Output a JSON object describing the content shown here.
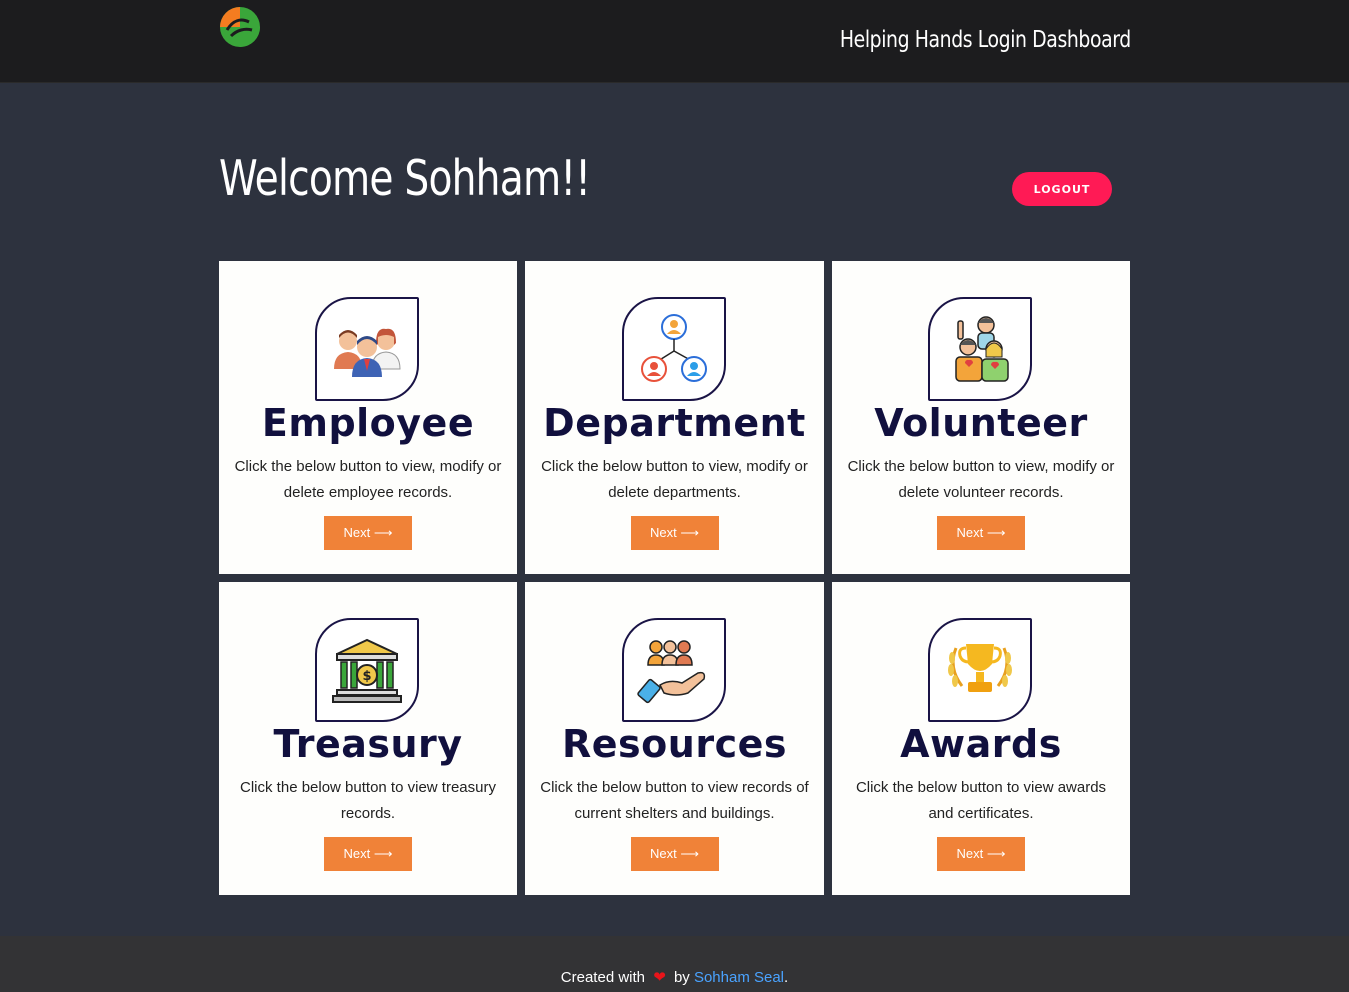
{
  "header": {
    "title": "Helping Hands Login Dashboard",
    "logo_icon": "helping-hands-logo",
    "colors": {
      "logo_orange": "#f47c20",
      "logo_green": "#3aa63a"
    }
  },
  "welcome": {
    "heading": "Welcome Sohham!!",
    "logout_label": "LOGOUT"
  },
  "cards": [
    {
      "icon": "team-people-icon",
      "title": "Employee",
      "desc": "Click the below button to view, modify or delete employee records.",
      "button": "Next ⟶"
    },
    {
      "icon": "org-structure-icon",
      "title": "Department",
      "desc": "Click the below button to view, modify or delete departments.",
      "button": "Next ⟶"
    },
    {
      "icon": "volunteers-icon",
      "title": "Volunteer",
      "desc": "Click the below button to view, modify or delete volunteer records.",
      "button": "Next ⟶"
    },
    {
      "icon": "bank-icon",
      "title": "Treasury",
      "desc": "Click the below button to view treasury records.",
      "button": "Next ⟶"
    },
    {
      "icon": "hand-people-icon",
      "title": "Resources",
      "desc": "Click the below button to view records of current shelters and buildings.",
      "button": "Next ⟶"
    },
    {
      "icon": "trophy-icon",
      "title": "Awards",
      "desc": "Click the below button to view awards and certificates.",
      "button": "Next ⟶"
    }
  ],
  "footer": {
    "prefix": "Created with",
    "heart": "❤",
    "by": "by",
    "author": "Sohham Seal",
    "suffix": "."
  },
  "colors": {
    "background": "#2d323e",
    "logout": "#ff1a55",
    "next_button": "#f08238",
    "card_title": "#11103e",
    "author_link": "#4aa3ff"
  }
}
